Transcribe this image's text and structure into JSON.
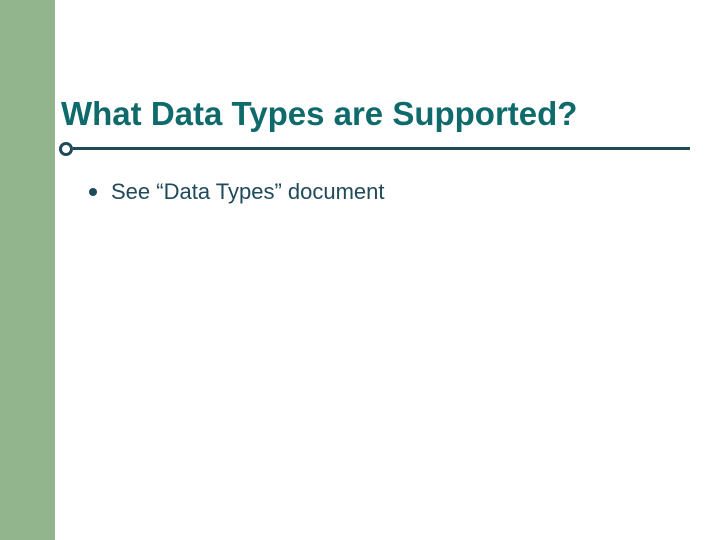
{
  "slide": {
    "title": "What Data Types are Supported?",
    "bullets": [
      "See “Data Types” document"
    ]
  }
}
